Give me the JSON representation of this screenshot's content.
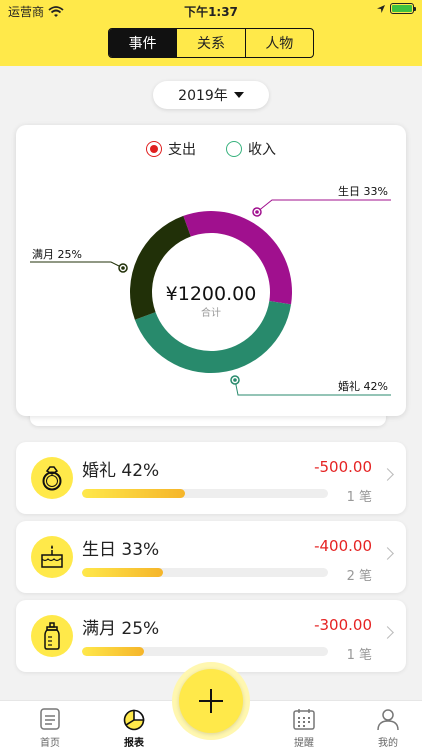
{
  "status_bar": {
    "carrier": "运营商",
    "time": "下午1:37"
  },
  "segments": [
    {
      "label": "事件"
    },
    {
      "label": "关系"
    },
    {
      "label": "人物"
    }
  ],
  "year_selector": {
    "label": "2019年"
  },
  "legend": {
    "expense": "支出",
    "income": "收入"
  },
  "chart_data": {
    "type": "pie",
    "center_value": "¥1200.00",
    "center_caption": "合计",
    "slices": [
      {
        "label": "生日 33%",
        "percent": 33,
        "color": "#a0108e"
      },
      {
        "label": "婚礼 42%",
        "percent": 42,
        "color": "#288a6c"
      },
      {
        "label": "满月 25%",
        "percent": 25,
        "color": "#213008"
      }
    ]
  },
  "rows": [
    {
      "name": "婚礼 42%",
      "amount": "-500.00",
      "count": "1 笔",
      "progress": 0.42,
      "icon": "ring-icon"
    },
    {
      "name": "生日 33%",
      "amount": "-400.00",
      "count": "2 笔",
      "progress": 0.33,
      "icon": "cake-icon"
    },
    {
      "name": "满月 25%",
      "amount": "-300.00",
      "count": "1 笔",
      "progress": 0.25,
      "icon": "baby-bottle-icon"
    }
  ],
  "tabs": [
    {
      "label": "首页",
      "icon": "document-icon"
    },
    {
      "label": "报表",
      "icon": "pie-chart-icon"
    },
    {
      "label": "提醒",
      "icon": "calendar-icon"
    },
    {
      "label": "我的",
      "icon": "person-icon"
    }
  ],
  "colors": {
    "brand": "#ffe94a",
    "expense": "#e52323"
  }
}
